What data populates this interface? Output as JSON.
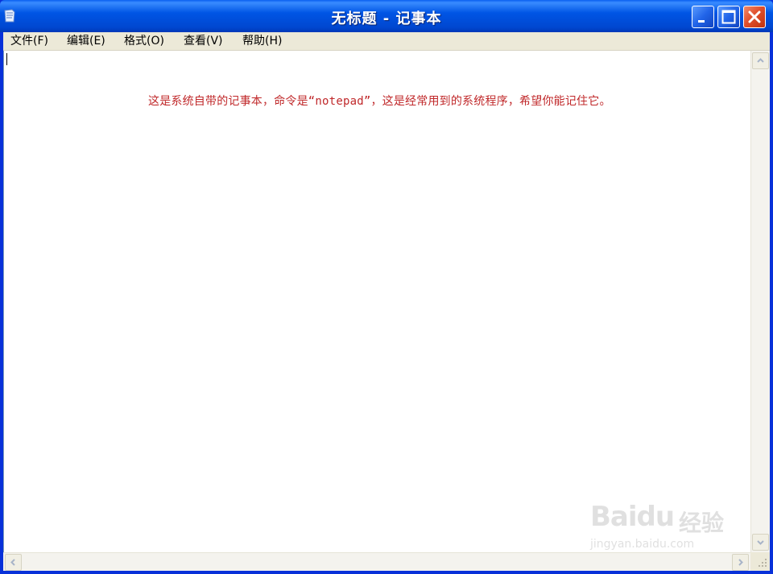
{
  "window": {
    "title": "无标题 - 记事本"
  },
  "menu": {
    "file": "文件(F)",
    "edit": "编辑(E)",
    "format": "格式(O)",
    "view": "查看(V)",
    "help": "帮助(H)"
  },
  "editor": {
    "text": "这是系统自带的记事本，命令是“notepad”，这是经常用到的系统程序，希望你能记住它。",
    "text_color": "#c0282a"
  },
  "watermark": {
    "brand": "Baidu",
    "brand_cn": "经验",
    "url": "jingyan.baidu.com"
  },
  "colors": {
    "titlebar": "#0055e5",
    "close_button": "#e0502d",
    "frame": "#ece9d8"
  },
  "icons": {
    "app": "notepad-icon",
    "minimize": "minimize-icon",
    "maximize": "maximize-icon",
    "close": "close-icon",
    "scroll_up": "arrow-up-icon",
    "scroll_down": "arrow-down-icon",
    "scroll_left": "arrow-left-icon",
    "scroll_right": "arrow-right-icon",
    "grip": "resize-grip-icon"
  }
}
